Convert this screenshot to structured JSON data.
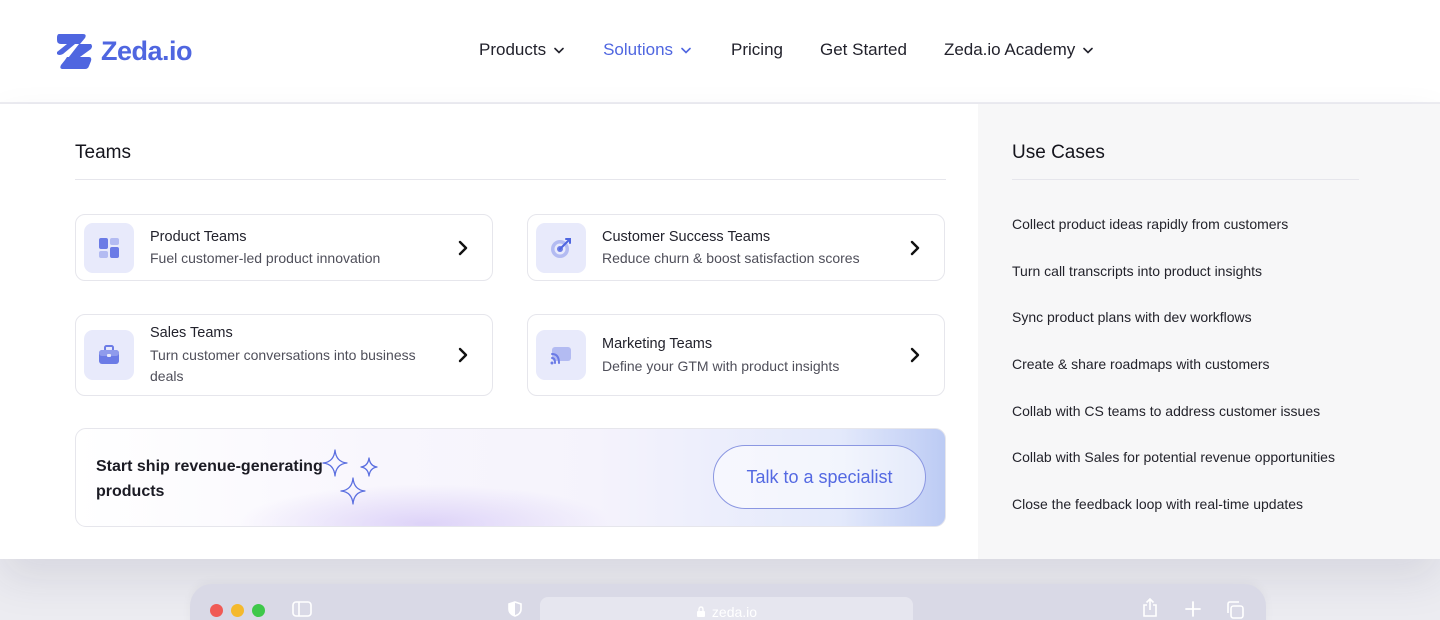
{
  "brand": {
    "name": "Zeda.io",
    "color": "#4f66e0"
  },
  "nav": {
    "items": [
      {
        "label": "Products",
        "has_dropdown": true,
        "active": false
      },
      {
        "label": "Solutions",
        "has_dropdown": true,
        "active": true
      },
      {
        "label": "Pricing",
        "has_dropdown": false,
        "active": false
      },
      {
        "label": "Get Started",
        "has_dropdown": false,
        "active": false
      },
      {
        "label": "Zeda.io Academy",
        "has_dropdown": true,
        "active": false
      }
    ]
  },
  "dropdown": {
    "teams_title": "Teams",
    "teams": [
      {
        "title": "Product Teams",
        "desc": "Fuel customer-led product innovation",
        "icon": "dashboard-icon"
      },
      {
        "title": "Customer Success Teams",
        "desc": "Reduce churn & boost satisfaction scores",
        "icon": "target-icon"
      },
      {
        "title": "Sales Teams",
        "desc": "Turn customer conversations into business deals",
        "icon": "briefcase-icon"
      },
      {
        "title": "Marketing Teams",
        "desc": "Define your GTM with product insights",
        "icon": "broadcast-icon"
      }
    ],
    "cta": {
      "text": "Start ship revenue-generating products",
      "button": "Talk to a specialist"
    },
    "use_cases_title": "Use Cases",
    "use_cases": [
      "Collect product ideas rapidly from customers",
      "Turn call transcripts into product insights",
      "Sync product plans with dev workflows",
      "Create & share roadmaps with customers",
      "Collab with CS teams to address customer issues",
      "Collab with Sales for potential revenue opportunities",
      "Close the feedback loop with real-time updates"
    ]
  },
  "browser": {
    "url": "zeda.io",
    "dots": [
      "#f05a55",
      "#f4b92d",
      "#3ec84a"
    ]
  }
}
